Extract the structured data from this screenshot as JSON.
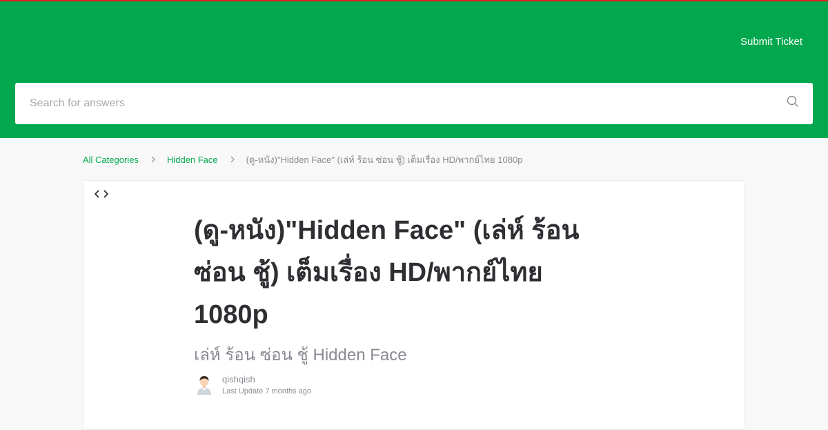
{
  "header": {
    "submit_ticket_label": "Submit Ticket",
    "brand_color": "#03a84e",
    "top_border_color": "#e02020"
  },
  "search": {
    "placeholder": "Search for answers",
    "value": "",
    "icon": "search-icon"
  },
  "breadcrumb": {
    "items": [
      {
        "label": "All Categories"
      },
      {
        "label": "Hidden Face"
      }
    ],
    "current": "(ดู-หนัง)\"Hidden Face\" (เล่ห์ ร้อน ซ่อน ชู้) เต็มเรื่อง HD/พากย์ไทย 1080p",
    "separator_icon": "chevron-right-icon"
  },
  "article": {
    "toggle_icon": "code-brackets-icon",
    "title": "(ดู-หนัง)\"Hidden Face\" (เล่ห์ ร้อน ซ่อน ชู้) เต็มเรื่อง HD/พากย์ไทย 1080p",
    "subtitle": "เล่ห์ ร้อน ซ่อน ชู้ Hidden Face",
    "author": {
      "name": "qishqish",
      "avatar_icon": "user-avatar-icon",
      "last_update": "Last Update 7 months ago"
    }
  }
}
